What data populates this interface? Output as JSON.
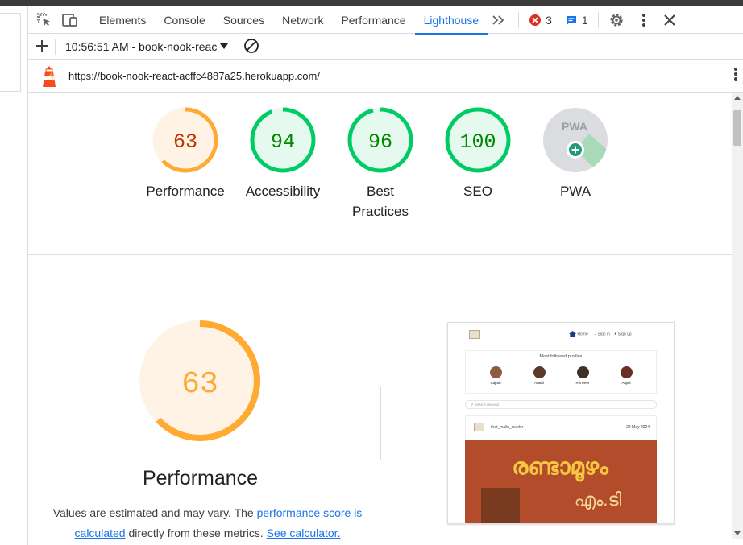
{
  "devtools": {
    "tabs": [
      {
        "label": "Elements",
        "active": false
      },
      {
        "label": "Console",
        "active": false
      },
      {
        "label": "Sources",
        "active": false
      },
      {
        "label": "Network",
        "active": false
      },
      {
        "label": "Performance",
        "active": false
      },
      {
        "label": "Lighthouse",
        "active": true
      }
    ],
    "errors_count": "3",
    "messages_count": "1",
    "report_selector": "10:56:51 AM - book-nook-reac",
    "url": "https://book-nook-react-acffc4887a25.herokuapp.com/"
  },
  "scores": {
    "performance": {
      "value": "63",
      "label": "Performance",
      "fraction": 0.63,
      "color": "#fa3"
    },
    "accessibility": {
      "value": "94",
      "label": "Accessibility",
      "fraction": 0.94,
      "color": "#0c6"
    },
    "best_practices": {
      "value": "96",
      "label_line1": "Best",
      "label_line2": "Practices",
      "fraction": 0.96,
      "color": "#0c6"
    },
    "seo": {
      "value": "100",
      "label": "SEO",
      "fraction": 1.0,
      "color": "#0c6"
    },
    "pwa": {
      "label": "PWA",
      "badge": "PWA"
    }
  },
  "perf_section": {
    "score": "63",
    "title": "Performance",
    "desc_part1": "Values are estimated and may vary. The ",
    "link1": "performance score is calculated",
    "desc_part2": " directly from these metrics. ",
    "link2": "See calculator."
  },
  "screenshot": {
    "nav_home": "Home",
    "nav_signin": "Sign in",
    "nav_signup": "Sign up",
    "profiles_title": "Most followed profiles",
    "profiles": [
      "Rajath",
      "Arathi",
      "Renveer",
      "Anjali"
    ],
    "search_placeholder": "Search reviews",
    "post_user": "that_mallu_reader",
    "post_date": "22 May 2024",
    "cover_title": "രണ്ടാമൂഴം",
    "cover_author": "എം.ടി"
  }
}
